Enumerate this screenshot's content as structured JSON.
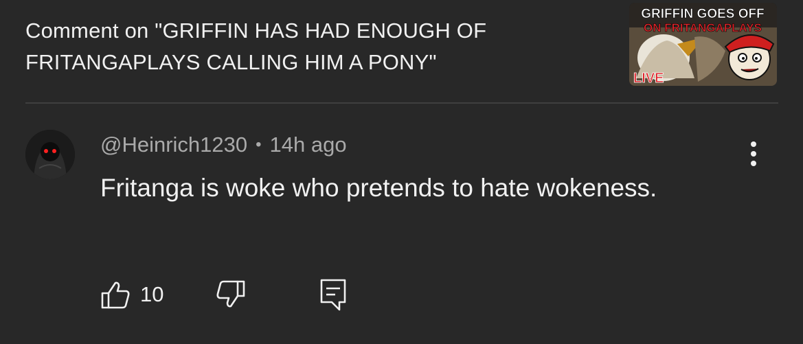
{
  "header": {
    "title": "Comment on \"GRIFFIN HAS HAD ENOUGH OF FRITANGAPLAYS CALLING HIM A PONY\""
  },
  "thumbnail": {
    "line1": "GRIFFIN GOES OFF",
    "line2": "ON FRITANGAPLAYS",
    "badge": "LIVE"
  },
  "comment": {
    "author": "@Heinrich1230",
    "separator": "•",
    "time": "14h ago",
    "text": "Fritanga is woke who pretends to hate wokeness."
  },
  "actions": {
    "like_count": "10"
  },
  "icons": {
    "like": "thumbs-up-icon",
    "dislike": "thumbs-down-icon",
    "reply": "reply-icon",
    "more": "more-vert-icon"
  },
  "colors": {
    "background": "#282828",
    "text_primary": "#f1f1f1",
    "text_secondary": "#aaaaaa",
    "divider": "#3f3f3f"
  }
}
